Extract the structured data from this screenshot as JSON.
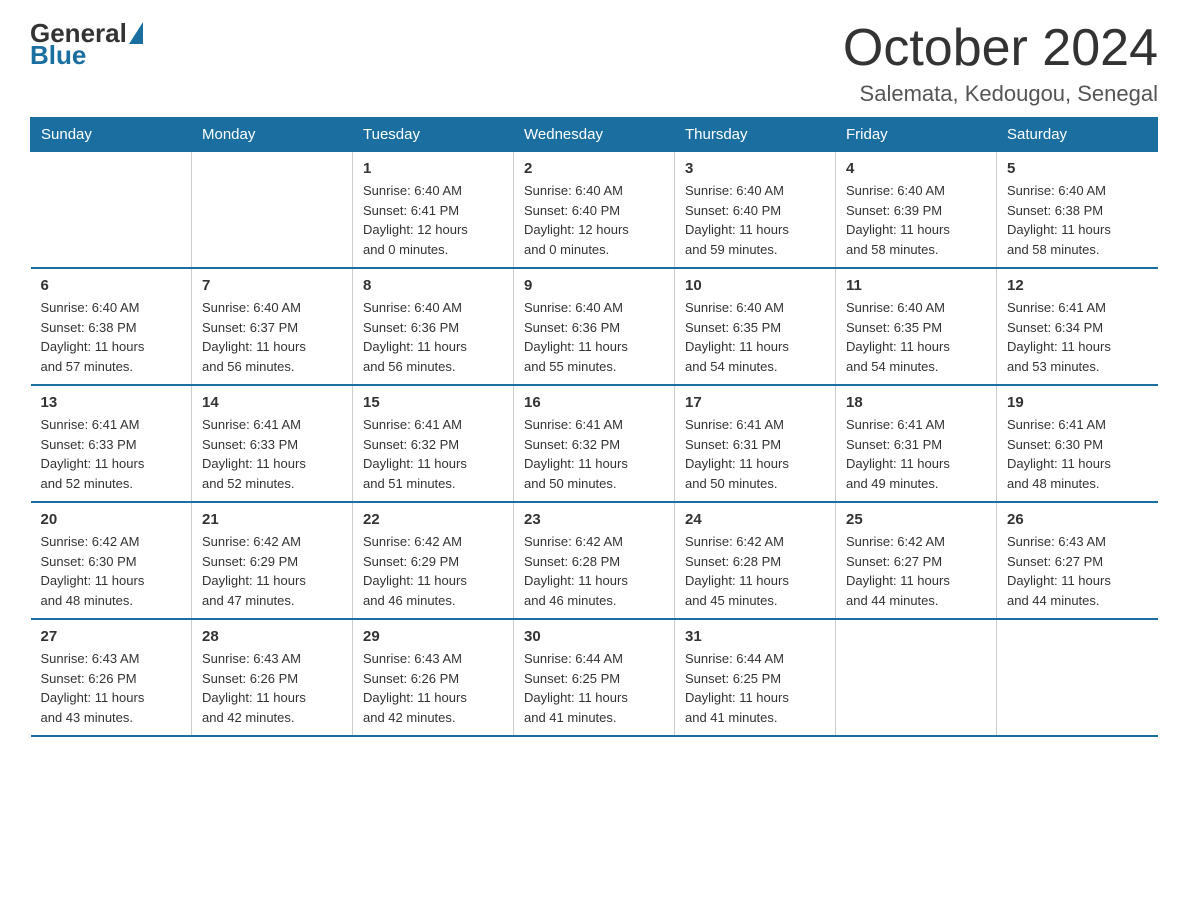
{
  "logo": {
    "general": "General",
    "blue": "Blue",
    "triangle_color": "#1a6fa0"
  },
  "title": {
    "month_year": "October 2024",
    "location": "Salemata, Kedougou, Senegal"
  },
  "header": {
    "days": [
      "Sunday",
      "Monday",
      "Tuesday",
      "Wednesday",
      "Thursday",
      "Friday",
      "Saturday"
    ]
  },
  "weeks": [
    {
      "days": [
        {
          "num": "",
          "info": ""
        },
        {
          "num": "",
          "info": ""
        },
        {
          "num": "1",
          "info": "Sunrise: 6:40 AM\nSunset: 6:41 PM\nDaylight: 12 hours\nand 0 minutes."
        },
        {
          "num": "2",
          "info": "Sunrise: 6:40 AM\nSunset: 6:40 PM\nDaylight: 12 hours\nand 0 minutes."
        },
        {
          "num": "3",
          "info": "Sunrise: 6:40 AM\nSunset: 6:40 PM\nDaylight: 11 hours\nand 59 minutes."
        },
        {
          "num": "4",
          "info": "Sunrise: 6:40 AM\nSunset: 6:39 PM\nDaylight: 11 hours\nand 58 minutes."
        },
        {
          "num": "5",
          "info": "Sunrise: 6:40 AM\nSunset: 6:38 PM\nDaylight: 11 hours\nand 58 minutes."
        }
      ]
    },
    {
      "days": [
        {
          "num": "6",
          "info": "Sunrise: 6:40 AM\nSunset: 6:38 PM\nDaylight: 11 hours\nand 57 minutes."
        },
        {
          "num": "7",
          "info": "Sunrise: 6:40 AM\nSunset: 6:37 PM\nDaylight: 11 hours\nand 56 minutes."
        },
        {
          "num": "8",
          "info": "Sunrise: 6:40 AM\nSunset: 6:36 PM\nDaylight: 11 hours\nand 56 minutes."
        },
        {
          "num": "9",
          "info": "Sunrise: 6:40 AM\nSunset: 6:36 PM\nDaylight: 11 hours\nand 55 minutes."
        },
        {
          "num": "10",
          "info": "Sunrise: 6:40 AM\nSunset: 6:35 PM\nDaylight: 11 hours\nand 54 minutes."
        },
        {
          "num": "11",
          "info": "Sunrise: 6:40 AM\nSunset: 6:35 PM\nDaylight: 11 hours\nand 54 minutes."
        },
        {
          "num": "12",
          "info": "Sunrise: 6:41 AM\nSunset: 6:34 PM\nDaylight: 11 hours\nand 53 minutes."
        }
      ]
    },
    {
      "days": [
        {
          "num": "13",
          "info": "Sunrise: 6:41 AM\nSunset: 6:33 PM\nDaylight: 11 hours\nand 52 minutes."
        },
        {
          "num": "14",
          "info": "Sunrise: 6:41 AM\nSunset: 6:33 PM\nDaylight: 11 hours\nand 52 minutes."
        },
        {
          "num": "15",
          "info": "Sunrise: 6:41 AM\nSunset: 6:32 PM\nDaylight: 11 hours\nand 51 minutes."
        },
        {
          "num": "16",
          "info": "Sunrise: 6:41 AM\nSunset: 6:32 PM\nDaylight: 11 hours\nand 50 minutes."
        },
        {
          "num": "17",
          "info": "Sunrise: 6:41 AM\nSunset: 6:31 PM\nDaylight: 11 hours\nand 50 minutes."
        },
        {
          "num": "18",
          "info": "Sunrise: 6:41 AM\nSunset: 6:31 PM\nDaylight: 11 hours\nand 49 minutes."
        },
        {
          "num": "19",
          "info": "Sunrise: 6:41 AM\nSunset: 6:30 PM\nDaylight: 11 hours\nand 48 minutes."
        }
      ]
    },
    {
      "days": [
        {
          "num": "20",
          "info": "Sunrise: 6:42 AM\nSunset: 6:30 PM\nDaylight: 11 hours\nand 48 minutes."
        },
        {
          "num": "21",
          "info": "Sunrise: 6:42 AM\nSunset: 6:29 PM\nDaylight: 11 hours\nand 47 minutes."
        },
        {
          "num": "22",
          "info": "Sunrise: 6:42 AM\nSunset: 6:29 PM\nDaylight: 11 hours\nand 46 minutes."
        },
        {
          "num": "23",
          "info": "Sunrise: 6:42 AM\nSunset: 6:28 PM\nDaylight: 11 hours\nand 46 minutes."
        },
        {
          "num": "24",
          "info": "Sunrise: 6:42 AM\nSunset: 6:28 PM\nDaylight: 11 hours\nand 45 minutes."
        },
        {
          "num": "25",
          "info": "Sunrise: 6:42 AM\nSunset: 6:27 PM\nDaylight: 11 hours\nand 44 minutes."
        },
        {
          "num": "26",
          "info": "Sunrise: 6:43 AM\nSunset: 6:27 PM\nDaylight: 11 hours\nand 44 minutes."
        }
      ]
    },
    {
      "days": [
        {
          "num": "27",
          "info": "Sunrise: 6:43 AM\nSunset: 6:26 PM\nDaylight: 11 hours\nand 43 minutes."
        },
        {
          "num": "28",
          "info": "Sunrise: 6:43 AM\nSunset: 6:26 PM\nDaylight: 11 hours\nand 42 minutes."
        },
        {
          "num": "29",
          "info": "Sunrise: 6:43 AM\nSunset: 6:26 PM\nDaylight: 11 hours\nand 42 minutes."
        },
        {
          "num": "30",
          "info": "Sunrise: 6:44 AM\nSunset: 6:25 PM\nDaylight: 11 hours\nand 41 minutes."
        },
        {
          "num": "31",
          "info": "Sunrise: 6:44 AM\nSunset: 6:25 PM\nDaylight: 11 hours\nand 41 minutes."
        },
        {
          "num": "",
          "info": ""
        },
        {
          "num": "",
          "info": ""
        }
      ]
    }
  ]
}
